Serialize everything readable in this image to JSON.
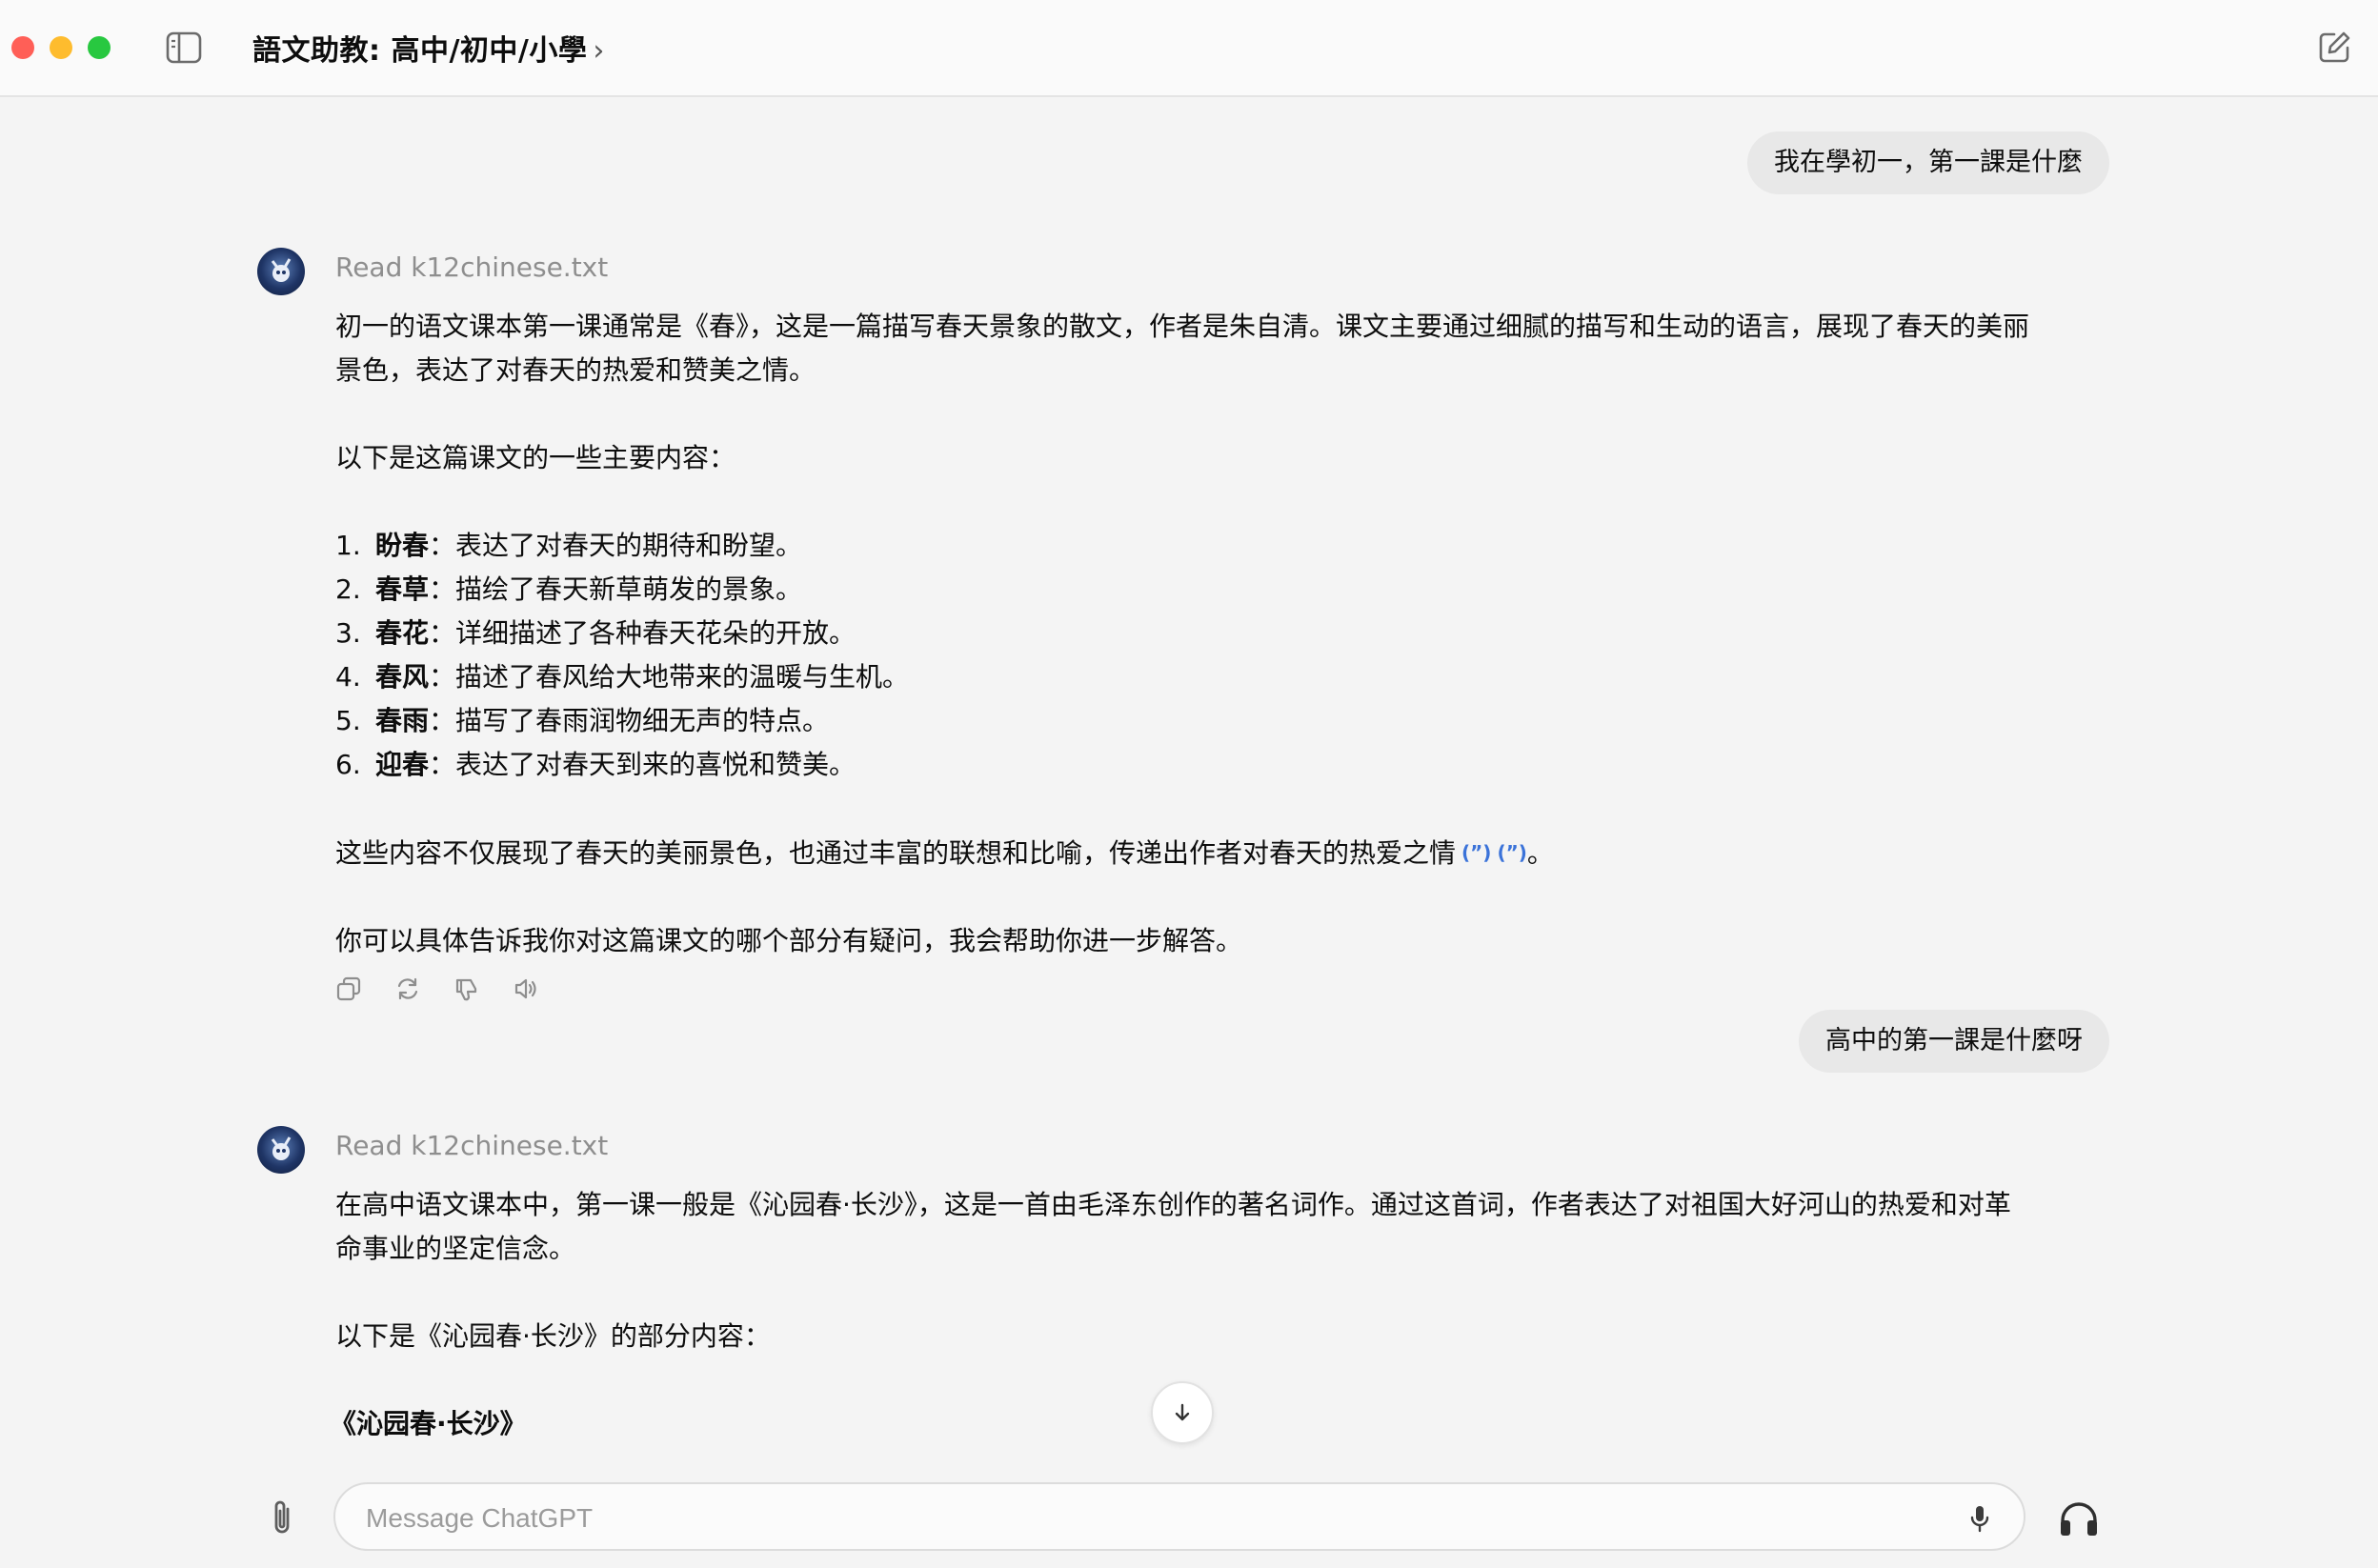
{
  "window": {
    "title": "語文助教: 高中/初中/小學",
    "title_chevron": "›"
  },
  "conversation": {
    "user_messages": [
      "我在學初一，第一課是什麼",
      "高中的第一課是什麼呀"
    ],
    "reply1": {
      "tool_status": "Read k12chinese.txt",
      "intro": "初一的语文课本第一课通常是《春》，这是一篇描写春天景象的散文，作者是朱自清。课文主要通过细腻的描写和生动的语言，展现了春天的美丽景色，表达了对春天的热爱和赞美之情。",
      "list_heading": "以下是这篇课文的一些主要内容：",
      "items": [
        {
          "num": "1.",
          "term": "盼春",
          "desc": "：表达了对春天的期待和盼望。"
        },
        {
          "num": "2.",
          "term": "春草",
          "desc": "：描绘了春天新草萌发的景象。"
        },
        {
          "num": "3.",
          "term": "春花",
          "desc": "：详细描述了各种春天花朵的开放。"
        },
        {
          "num": "4.",
          "term": "春风",
          "desc": "：描述了春风给大地带来的温暖与生机。"
        },
        {
          "num": "5.",
          "term": "春雨",
          "desc": "：描写了春雨润物细无声的特点。"
        },
        {
          "num": "6.",
          "term": "迎春",
          "desc": "：表达了对春天到来的喜悦和赞美。"
        }
      ],
      "summary": "这些内容不仅展现了春天的美丽景色，也通过丰富的联想和比喻，传递出作者对春天的热爱之情",
      "citations": [
        "(”)",
        "(”)"
      ],
      "summary_end": "。",
      "closing": "你可以具体告诉我你对这篇课文的哪个部分有疑问，我会帮助你进一步解答。"
    },
    "reply2": {
      "tool_status": "Read k12chinese.txt",
      "intro": "在高中语文课本中，第一课一般是《沁园春·长沙》，这是一首由毛泽东创作的著名词作。通过这首词，作者表达了对祖国大好河山的热爱和对革命事业的坚定信念。",
      "list_heading": "以下是《沁园春·长沙》的部分内容：",
      "poem_title": "《沁园春·长沙》"
    }
  },
  "composer": {
    "placeholder": "Message ChatGPT"
  },
  "icons": {
    "sidebar": "sidebar-toggle-icon",
    "new_chat": "new-chat-icon",
    "copy": "copy-icon",
    "regenerate": "regenerate-icon",
    "thumbs_down": "thumbs-down-icon",
    "speaker": "read-aloud-icon",
    "scroll_down": "arrow-down-icon",
    "attach": "paperclip-icon",
    "mic": "microphone-icon",
    "voice_mode": "headphones-icon"
  },
  "colors": {
    "background": "#f4f4f4",
    "user_bubble": "#e8e8e8",
    "citation": "#3b73d9",
    "muted": "#8e8e8e"
  }
}
